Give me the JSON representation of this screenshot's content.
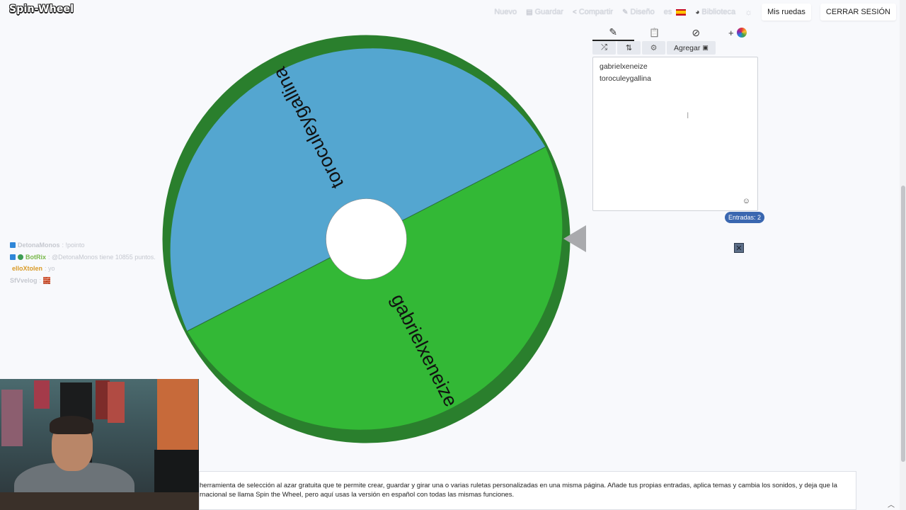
{
  "header": {
    "logo": "Spin-Wheel",
    "nav": [
      {
        "icon": "new-icon",
        "label": "Nuevo"
      },
      {
        "icon": "save-icon",
        "label": "Guardar"
      },
      {
        "icon": "share-icon",
        "label": "Compartir"
      },
      {
        "icon": "pencil-icon",
        "label": "Diseño"
      },
      {
        "icon": "spain-flag-icon",
        "label": "es"
      },
      {
        "icon": "globe-icon",
        "label": "Biblioteca"
      }
    ],
    "theme_icon": "sun-icon",
    "my_wheels": "Mis ruedas",
    "logout": "CERRAR SESIÓN"
  },
  "wheel": {
    "segments": [
      {
        "label": "toroculeygallina",
        "color": "#54a6d0"
      },
      {
        "label": "gabrielxeneize",
        "color": "#33b836"
      }
    ]
  },
  "chat": [
    {
      "user": "DetonaMonos",
      "user_color": "#c5c8cf",
      "badge_color": "#2f86d8",
      "msg": "!pointo"
    },
    {
      "user": "BotRix",
      "user_color": "#78b84b",
      "badge_color": "#2f86d8",
      "msg": "@DetonaMonos tiene 10855 puntos."
    },
    {
      "user": "elloXtolen",
      "user_color": "#d99a27",
      "badge_color": "",
      "msg": "yo"
    },
    {
      "user": "SfVvelog",
      "user_color": "#c5c8cf",
      "badge_color": "",
      "msg": "🧱"
    }
  ],
  "panel": {
    "tabs": [
      {
        "icon": "pencil-icon",
        "glyph": "✎"
      },
      {
        "icon": "clipboard-icon",
        "glyph": "📋"
      },
      {
        "icon": "eye-hidden-icon",
        "glyph": "⊘"
      },
      {
        "icon": "add-color-icon",
        "glyph": "+"
      }
    ],
    "tools": [
      {
        "icon": "shuffle-icon",
        "glyph": "⤮"
      },
      {
        "icon": "sort-icon",
        "glyph": "⇅"
      },
      {
        "icon": "settings-icon",
        "glyph": "⚙"
      }
    ],
    "add_label": "Agregar",
    "entries": [
      "gabrielxeneize",
      "toroculeygallina"
    ],
    "count_label": "Entradas: 2"
  },
  "description": {
    "line1": "herramienta de selección al azar gratuita que te permite crear, guardar y girar una o varias ruletas personalizadas en una misma página. Añade tus propias entradas, aplica temas y cambia los sonidos, y deja que la",
    "line2": "rnacional se llama Spin the Wheel, pero aquí usas la versión en español con todas las mismas funciones."
  }
}
